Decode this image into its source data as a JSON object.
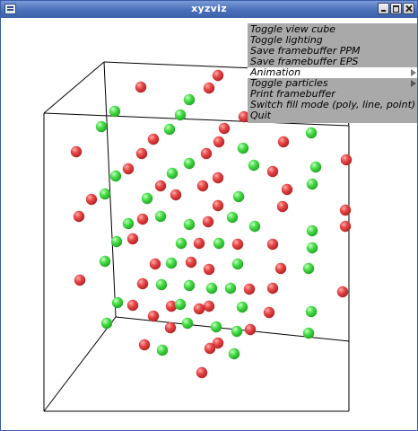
{
  "window": {
    "title": "xyzviz"
  },
  "colors": {
    "titlebar": "#4a6fb8",
    "menu_bg": "#a9a9a9",
    "menu_active": "#ffffff",
    "particle_red": "#e84848",
    "particle_green": "#4ade4a",
    "cube_line": "#000000"
  },
  "icons": [
    "window-menu-icon",
    "minimize-icon",
    "maximize-icon",
    "close-icon",
    "submenu-arrow-icon"
  ],
  "menu": {
    "items": [
      {
        "label": "Toggle view cube",
        "active": false,
        "submenu": false
      },
      {
        "label": "Toggle lighting",
        "active": false,
        "submenu": false
      },
      {
        "label": "Save framebuffer PPM",
        "active": false,
        "submenu": false
      },
      {
        "label": "Save framebuffer EPS",
        "active": false,
        "submenu": false
      },
      {
        "label": "Animation",
        "active": true,
        "submenu": true
      },
      {
        "label": "Toggle particles",
        "active": false,
        "submenu": true
      },
      {
        "label": "Print framebuffer",
        "active": false,
        "submenu": false
      },
      {
        "label": "Switch fill mode (poly, line, point)",
        "active": false,
        "submenu": false
      },
      {
        "label": "Quit",
        "active": false,
        "submenu": false
      }
    ]
  }
}
